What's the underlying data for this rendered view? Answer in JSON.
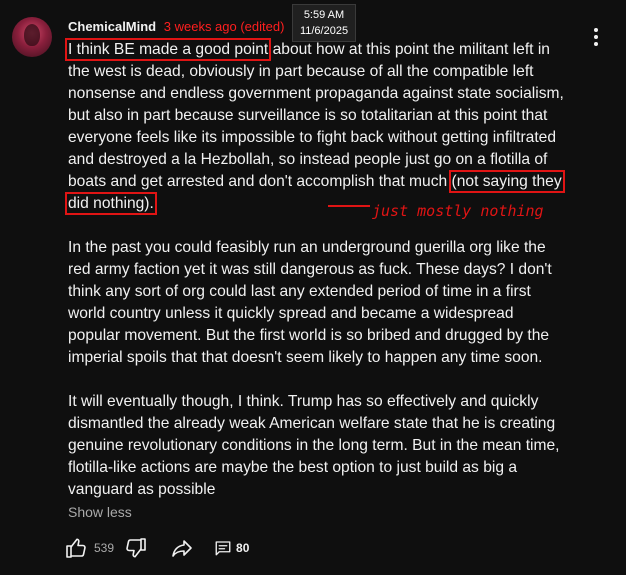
{
  "comment": {
    "author": "ChemicalMind",
    "timestamp": "3 weeks ago (edited)",
    "paragraphs": [
      {
        "highlight_start": "I think BE made a good point",
        "text_after": " about how at this point the militant left in the west is dead, obviously in part because of all the compatible left nonsense and endless government propaganda against state socialism, but also in part because surveillance is so totalitarian at this point that everyone feels like its impossible to fight back without getting infiltrated and destroyed a la Hezbollah, so instead people just go on a flotilla of boats and get arrested and don't accomplish that much ",
        "highlight_end": "(not saying they did nothing)."
      },
      {
        "text": "In the past you could feasibly run an underground guerilla org like the red army faction yet it was still dangerous as fuck. These days? I don't think any sort of org could last any extended period of time in a first world country unless it quickly spread and became a widespread popular movement. But the first world is so bribed and drugged by the imperial spoils that that doesn't seem likely to happen any time soon."
      },
      {
        "text": "It will eventually though, I think. Trump has so effectively and quickly dismantled the already weak American welfare state that he is creating genuine revolutionary conditions in the long term. But in the mean time, flotilla-like actions are maybe the best option to just build as big a vanguard as possible"
      }
    ],
    "show_less_label": "Show less",
    "like_count": "539",
    "reply_count": "80"
  },
  "annotation": {
    "text": "just mostly nothing",
    "color": "#e01414"
  },
  "clock": {
    "time": "5:59 AM",
    "date": "11/6/2025"
  },
  "icons": [
    "avatar",
    "more-vert-icon",
    "thumb-up-icon",
    "thumb-down-icon",
    "share-icon",
    "comment-icon"
  ],
  "colors": {
    "background": "#0f0f0f",
    "text": "#f1f1f1",
    "muted": "#aaaaaa",
    "edited_timestamp": "#ff1f1f",
    "highlight_box": "#e01414"
  }
}
